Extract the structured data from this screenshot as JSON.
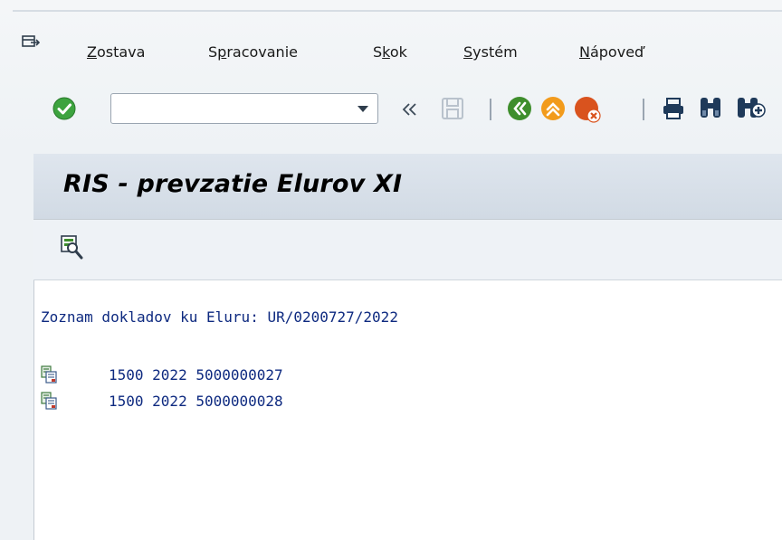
{
  "menu": {
    "items": [
      {
        "label": "Zostava",
        "underline": "Z",
        "rest": "ostava"
      },
      {
        "label": "Spracovanie",
        "underline_prefix": "S",
        "underline": "p",
        "rest": "racovanie"
      },
      {
        "label": "Skok",
        "underline_prefix": "S",
        "underline": "k",
        "rest": "ok"
      },
      {
        "label": "Systém",
        "underline": "S",
        "rest": "ystém"
      },
      {
        "label": "Nápoveď",
        "underline": "N",
        "rest": "ápoveď"
      }
    ]
  },
  "toolbar": {
    "command_field_value": "",
    "icons": [
      "enter-check-icon",
      "command-dropdown-icon",
      "collapse-icon",
      "save-icon",
      "back-icon",
      "exit-icon",
      "cancel-icon",
      "print-icon",
      "find-icon",
      "find-next-icon"
    ]
  },
  "window": {
    "title": "RIS - prevzatie Elurov XI",
    "app_toolbar_icon": "display-document-icon"
  },
  "content": {
    "header_line": "Zoznam dokladov ku Eluru: UR/0200727/2022",
    "documents": [
      {
        "text": "1500 2022 5000000027"
      },
      {
        "text": "1500 2022 5000000028"
      }
    ]
  },
  "colors": {
    "accent_text": "#0e2a80",
    "enter_green": "#3da33f",
    "back_green": "#3e8e2c",
    "exit_orange": "#f29b1c",
    "cancel_red": "#d9531e"
  }
}
